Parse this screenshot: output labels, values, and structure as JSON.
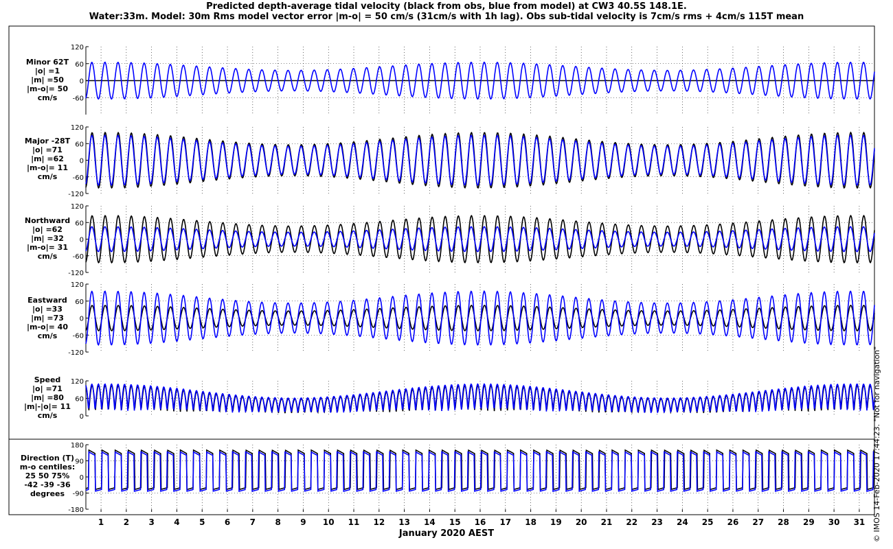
{
  "title": {
    "line1": "Predicted depth-average tidal velocity (black from obs, blue from model) at CW3 40.5S 148.1E.",
    "line2": "Water:33m. Model: 30m  Rms model vector error |m-o| = 50 cm/s (31cm/s with 1h lag). Obs sub-tidal velocity is 7cm/s rms + 4cm/s 115T mean"
  },
  "xlabel": "January 2020 AEST",
  "footer": "© IMOS 14-Feb-2020 17:44:23. \"Not for navigation\"",
  "colors": {
    "obs": "#000000",
    "model": "#0000ff",
    "grid": "#000000",
    "background": "#ffffff"
  },
  "panels": [
    {
      "id": "minor",
      "label_lines": [
        "Minor 62T",
        "|o| =1",
        "|m| =50",
        "|m-o|= 50",
        "cm/s"
      ]
    },
    {
      "id": "major",
      "label_lines": [
        "Major -28T",
        "|o| =71",
        "|m| =62",
        "|m-o|= 11",
        "cm/s"
      ]
    },
    {
      "id": "north",
      "label_lines": [
        "Northward",
        "|o| =62",
        "|m| =32",
        "|m-o|= 31",
        "cm/s"
      ]
    },
    {
      "id": "east",
      "label_lines": [
        "Eastward",
        "|o| =33",
        "|m| =73",
        "|m-o|= 40",
        "cm/s"
      ]
    },
    {
      "id": "speed",
      "label_lines": [
        "Speed",
        "|o| =71",
        "|m| =80",
        "|m|-|o|= 11",
        "cm/s"
      ]
    },
    {
      "id": "dir",
      "label_lines": [
        "Direction (T)",
        "m-o centiles:",
        "25  50  75%",
        "-42  -39  -36",
        "degrees"
      ]
    }
  ],
  "chart_data": [
    {
      "type": "line",
      "panel": "minor",
      "ylim": [
        -120,
        120
      ],
      "yticks": [
        "120",
        "60",
        "0",
        "-60"
      ],
      "series": [
        {
          "color": "#000000",
          "amplitude": 1
        },
        {
          "color": "#0000ff",
          "amplitude": 65
        }
      ]
    },
    {
      "type": "line",
      "panel": "major",
      "ylim": [
        -120,
        120
      ],
      "yticks": [
        "120",
        "60",
        "0",
        "-60",
        "-120"
      ],
      "series": [
        {
          "color": "#000000",
          "amplitude": 100
        },
        {
          "color": "#0000ff",
          "amplitude": 90
        }
      ]
    },
    {
      "type": "line",
      "panel": "north",
      "ylim": [
        -120,
        120
      ],
      "yticks": [
        "120",
        "60",
        "0",
        "-60",
        "-120"
      ],
      "series": [
        {
          "color": "#000000",
          "amplitude": 85
        },
        {
          "color": "#0000ff",
          "amplitude": 45
        }
      ]
    },
    {
      "type": "line",
      "panel": "east",
      "ylim": [
        -120,
        120
      ],
      "yticks": [
        "120",
        "60",
        "0",
        "-60",
        "-120"
      ],
      "series": [
        {
          "color": "#000000",
          "amplitude": 45
        },
        {
          "color": "#0000ff",
          "amplitude": 95
        }
      ]
    },
    {
      "type": "line",
      "panel": "speed",
      "ylim": [
        0,
        120
      ],
      "yticks": [
        "120",
        "60",
        "0"
      ],
      "series": [
        {
          "color": "#000000",
          "amplitude": 110
        },
        {
          "color": "#0000ff",
          "amplitude": 115
        }
      ]
    },
    {
      "type": "line",
      "panel": "dir",
      "ylim": [
        -180,
        180
      ],
      "yticks": [
        "180",
        "90",
        "0",
        "-90",
        "-180"
      ],
      "series": [
        {
          "color": "#000000",
          "high": 150,
          "low": -70
        },
        {
          "color": "#0000ff",
          "high": 140,
          "low": -80
        }
      ]
    }
  ],
  "x_axis": {
    "xlim": [
      0.4,
      31.6
    ],
    "ticks": [
      "1",
      "2",
      "3",
      "4",
      "5",
      "6",
      "7",
      "8",
      "9",
      "10",
      "11",
      "12",
      "13",
      "14",
      "15",
      "16",
      "17",
      "18",
      "19",
      "20",
      "21",
      "22",
      "23",
      "24",
      "25",
      "26",
      "27",
      "28",
      "29",
      "30",
      "31"
    ]
  }
}
